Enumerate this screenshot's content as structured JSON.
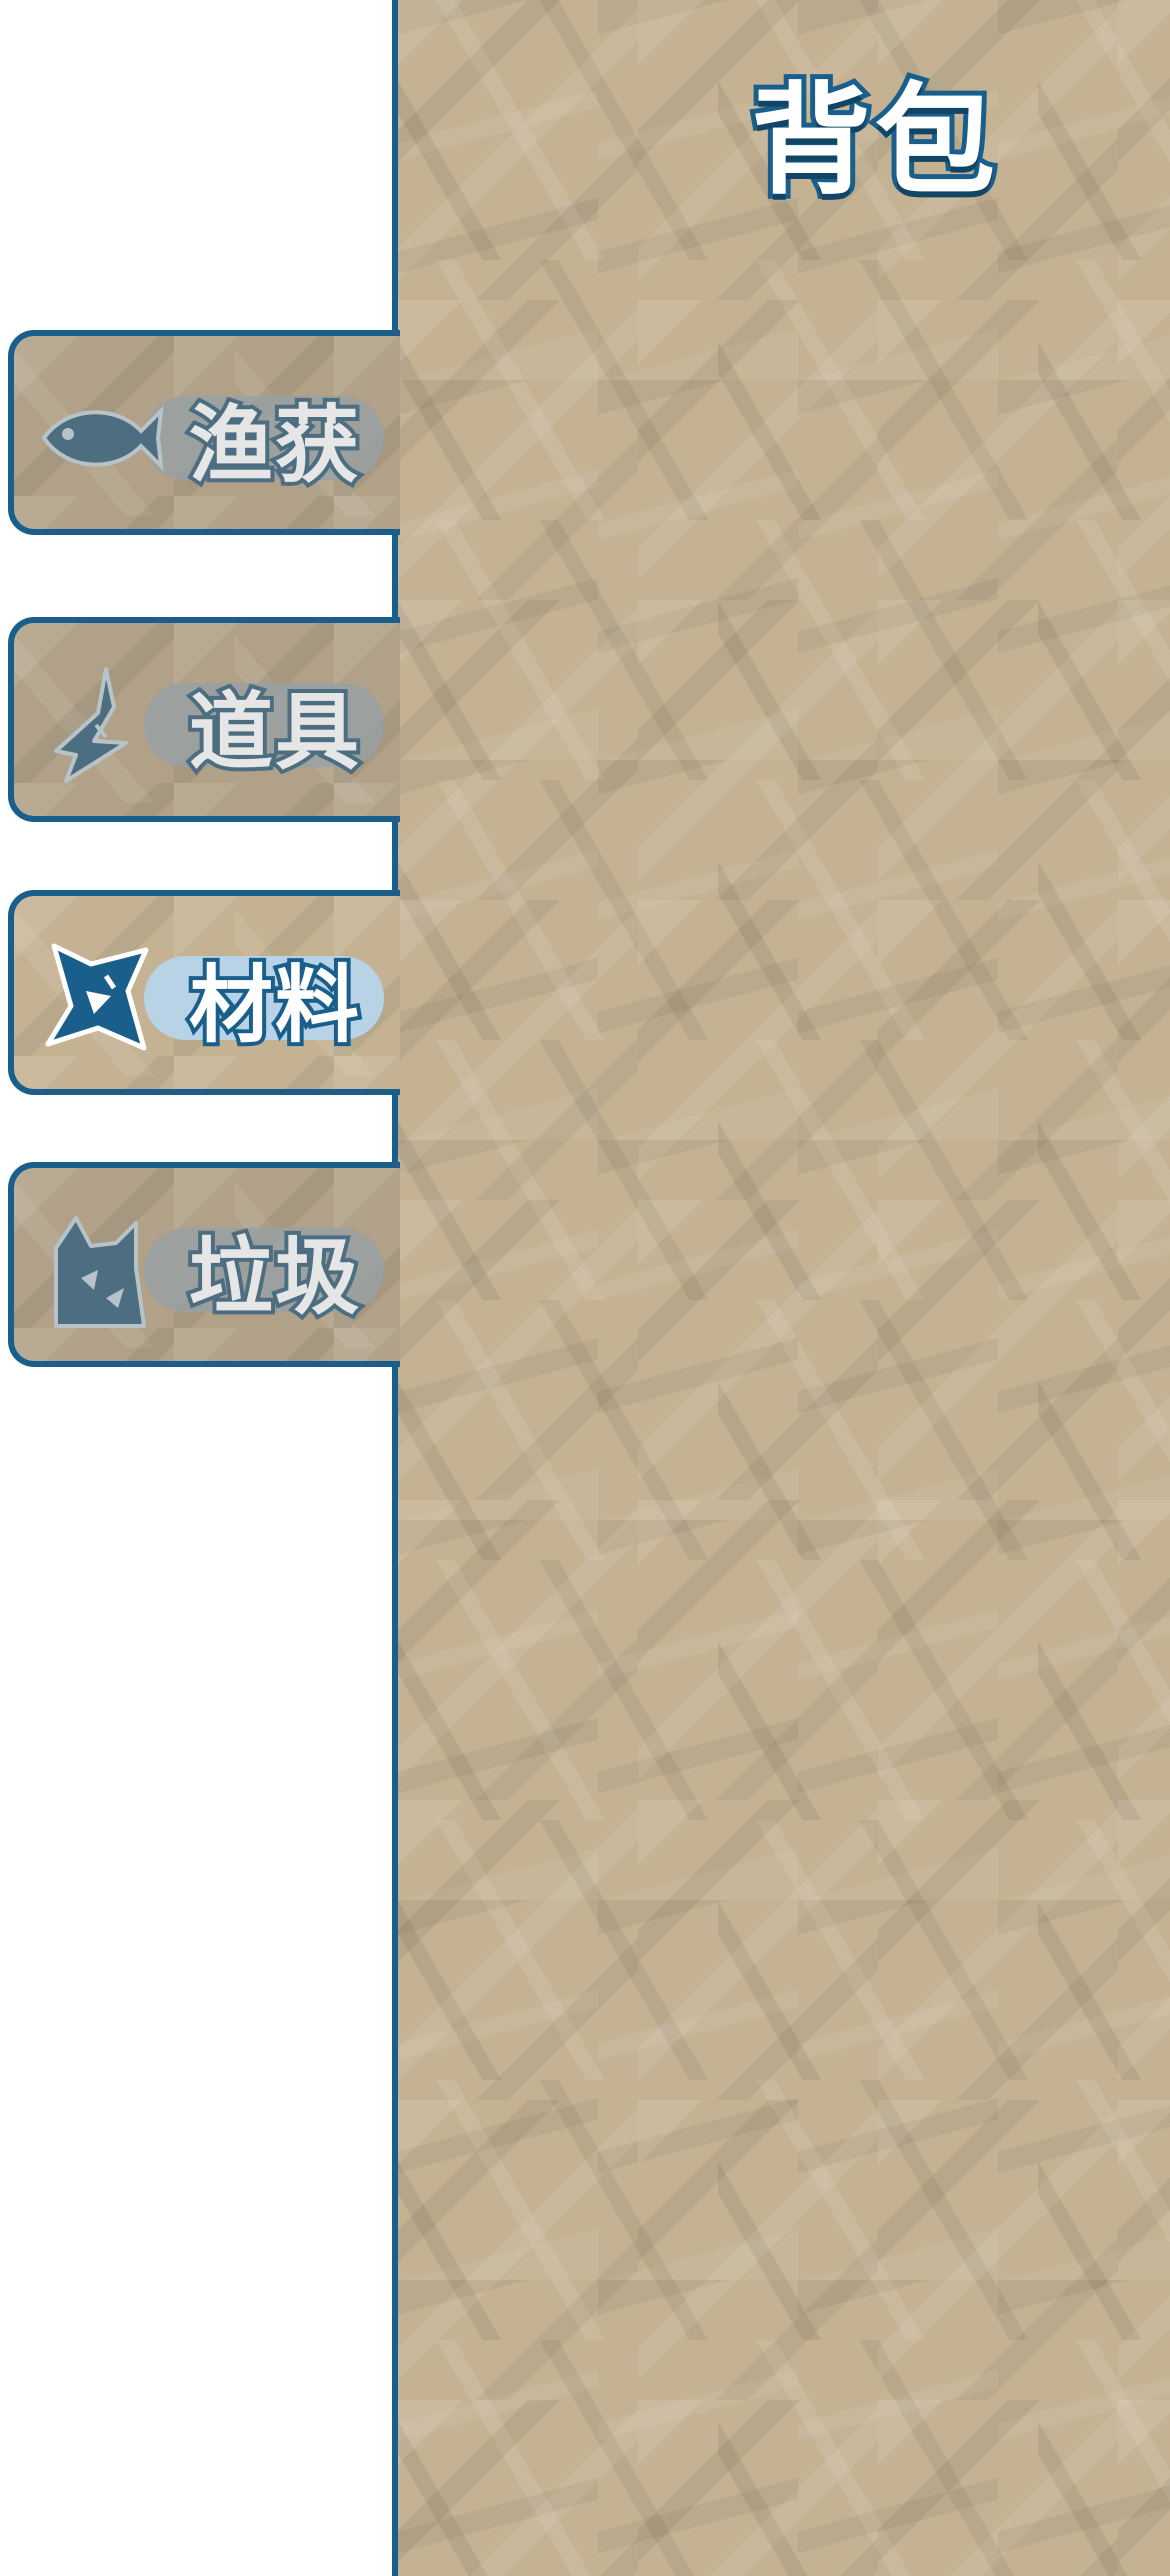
{
  "title": "背包",
  "tabs": [
    {
      "label": "渔获",
      "icon": "fish-icon",
      "active": false
    },
    {
      "label": "道具",
      "icon": "hook-icon",
      "active": false
    },
    {
      "label": "材料",
      "icon": "material-shard-icon",
      "active": true
    },
    {
      "label": "垃圾",
      "icon": "trash-bag-icon",
      "active": false
    }
  ],
  "colors": {
    "border": "#1a5f8c",
    "paper": "#c4b293",
    "inactive_icon": "#4d6e80",
    "active_icon": "#1a5f8c",
    "active_pill": "#b9d3e6"
  }
}
